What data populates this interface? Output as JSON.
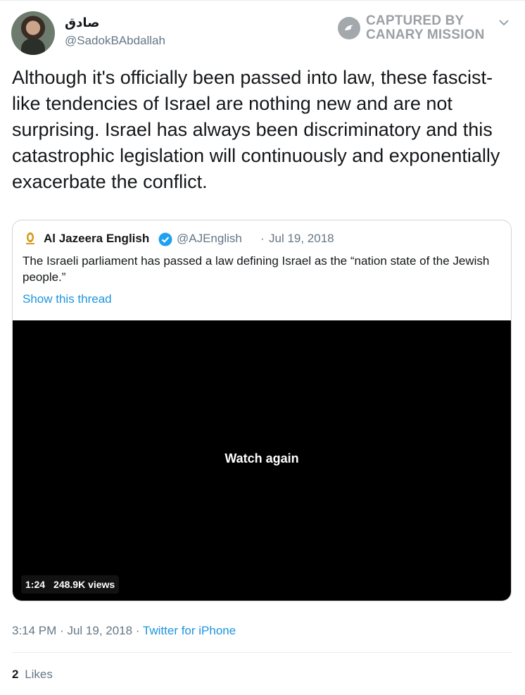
{
  "author": {
    "display_name": "صادق",
    "handle": "@SadokBAbdallah"
  },
  "watermark": {
    "line1": "CAPTURED BY",
    "line2": "CANARY MISSION"
  },
  "tweet": {
    "text": "Although it's officially been passed into law, these fascist-like tendencies of Israel are nothing new and are not surprising. Israel has always been discriminatory and this catastrophic legislation will continuously and exponentially exacerbate the conflict."
  },
  "quoted": {
    "name": "Al Jazeera English",
    "handle": "@AJEnglish",
    "separator": "·",
    "date": "Jul 19, 2018",
    "text": "The Israeli parliament has passed a law defining Israel as the “nation state of the Jewish people.”",
    "show_thread": "Show this thread",
    "video": {
      "overlay_text": "Watch again",
      "duration": "1:24",
      "views": "248.9K views"
    }
  },
  "meta": {
    "time": "3:14 PM",
    "sep1": "·",
    "date": "Jul 19, 2018",
    "sep2": "·",
    "source": "Twitter for iPhone"
  },
  "stats": {
    "likes_count": "2",
    "likes_label": "Likes"
  },
  "colors": {
    "link": "#1b95e0",
    "muted": "#657786",
    "verified": "#1da1f2"
  }
}
